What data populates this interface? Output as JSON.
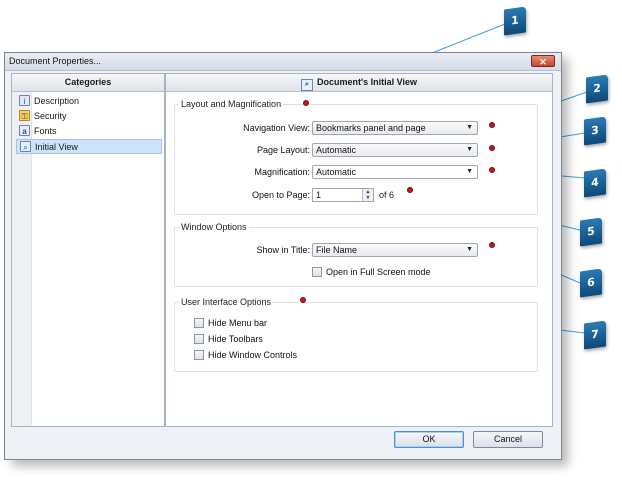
{
  "window": {
    "title": "Document Properties...",
    "close_glyph": "✕"
  },
  "categories": {
    "header": "Categories",
    "items": [
      {
        "label": "Description",
        "icon": "description-icon",
        "selected": false
      },
      {
        "label": "Security",
        "icon": "security-icon",
        "selected": false
      },
      {
        "label": "Fonts",
        "icon": "fonts-icon",
        "selected": false
      },
      {
        "label": "Initial View",
        "icon": "initial-view-icon",
        "selected": true
      }
    ]
  },
  "main": {
    "header": "Document's Initial View",
    "layout_group": {
      "title": "Layout and Magnification",
      "navigation_view": {
        "label": "Navigation View:",
        "value": "Bookmarks panel and page"
      },
      "page_layout": {
        "label": "Page Layout:",
        "value": "Automatic"
      },
      "magnification": {
        "label": "Magnification:",
        "value": "Automatic"
      },
      "open_to_page": {
        "label": "Open to Page:",
        "value": "1",
        "of_text": "of 6"
      }
    },
    "window_group": {
      "title": "Window Options",
      "show_in_title": {
        "label": "Show in Title:",
        "value": "File Name"
      },
      "full_screen": {
        "label": "Open in Full Screen mode",
        "checked": false
      }
    },
    "ui_group": {
      "title": "User Interface Options",
      "options": [
        {
          "label": "Hide Menu bar",
          "checked": false
        },
        {
          "label": "Hide Toolbars",
          "checked": false
        },
        {
          "label": "Hide Window Controls",
          "checked": false
        }
      ]
    }
  },
  "buttons": {
    "ok": "OK",
    "cancel": "Cancel"
  },
  "callouts": [
    "1",
    "2",
    "3",
    "4",
    "5",
    "6",
    "7"
  ],
  "colors": {
    "callout": "#1a5e95",
    "marker": "#c5161c",
    "leader_line": "#3399dd",
    "selection": "#cde3f7"
  }
}
